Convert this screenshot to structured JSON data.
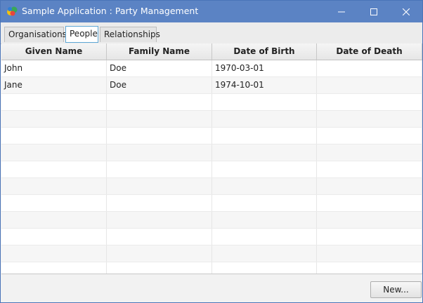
{
  "window": {
    "title": "Sample Application : Party Management",
    "titlebar_color": "#5b83c4"
  },
  "tabs": [
    {
      "label": "Organisations",
      "active": false
    },
    {
      "label": "People",
      "active": true
    },
    {
      "label": "Relationships",
      "active": false
    }
  ],
  "table": {
    "columns": [
      "Given Name",
      "Family Name",
      "Date of Birth",
      "Date of Death"
    ],
    "rows": [
      [
        "John",
        "Doe",
        "1970-03-01",
        ""
      ],
      [
        "Jane",
        "Doe",
        "1974-10-01",
        ""
      ]
    ]
  },
  "footer": {
    "new_label": "New..."
  },
  "icons": {
    "app": "app-icon",
    "minimize": "minimize-icon",
    "maximize": "maximize-icon",
    "close": "close-icon"
  }
}
